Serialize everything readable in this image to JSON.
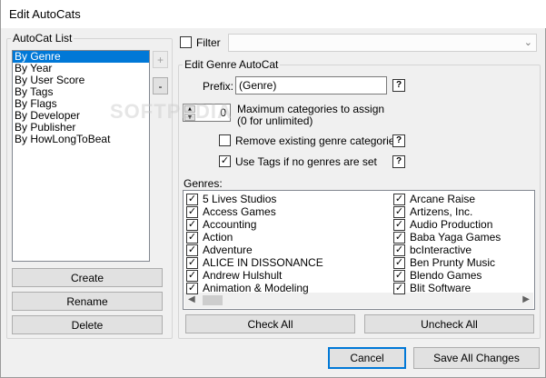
{
  "window": {
    "title": "Edit AutoCats"
  },
  "autocat_list": {
    "legend": "AutoCat List",
    "items": [
      "By Genre",
      "By Year",
      "By User Score",
      "By Tags",
      "By Flags",
      "By Developer",
      "By Publisher",
      "By HowLongToBeat"
    ],
    "selected_index": 0,
    "add_label": "+",
    "remove_label": "-",
    "create_label": "Create",
    "rename_label": "Rename",
    "delete_label": "Delete"
  },
  "filter": {
    "label": "Filter",
    "checked": false,
    "value": ""
  },
  "genre_autocat": {
    "legend": "Edit Genre AutoCat",
    "prefix_label": "Prefix:",
    "prefix_value": "(Genre)",
    "help_label": "?",
    "max_value": "0",
    "max_label_line1": "Maximum categories to assign",
    "max_label_line2": "(0 for unlimited)",
    "remove_existing_label": "Remove existing genre categories",
    "remove_existing_checked": false,
    "use_tags_label": "Use Tags if no genres are set",
    "use_tags_checked": true,
    "genres_label": "Genres:",
    "genres_col1": [
      "5 Lives Studios",
      "Access Games",
      "Accounting",
      "Action",
      "Adventure",
      "ALICE IN DISSONANCE",
      "Andrew Hulshult",
      "Animation & Modeling"
    ],
    "genres_col2": [
      "Arcane Raise",
      "Artizens, Inc.",
      "Audio Production",
      "Baba Yaga Games",
      "bcInteractive",
      "Ben Prunty Music",
      "Blendo Games",
      "Blit Software"
    ],
    "check_all_label": "Check All",
    "uncheck_all_label": "Uncheck All"
  },
  "footer": {
    "cancel_label": "Cancel",
    "save_label": "Save All Changes"
  },
  "colors": {
    "selection": "#0078d7",
    "window_bg": "#f0f0f0"
  }
}
